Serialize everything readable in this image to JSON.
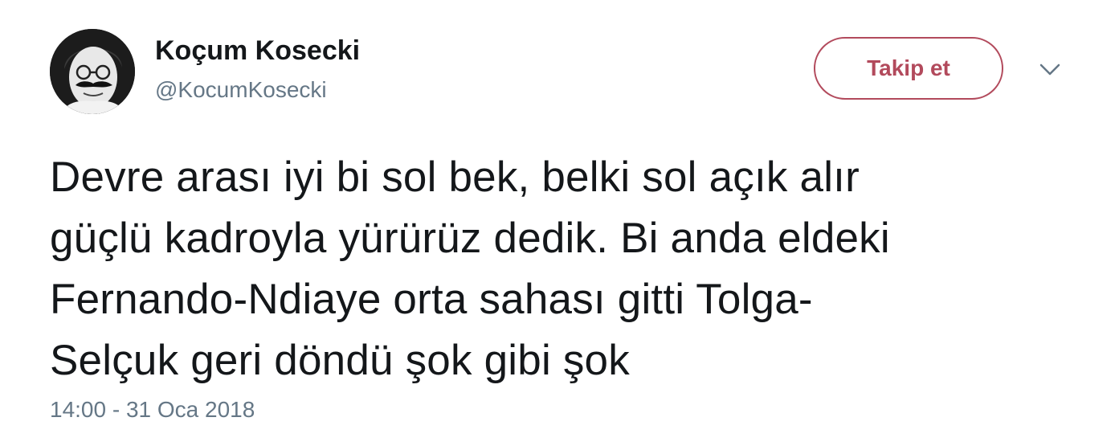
{
  "user": {
    "display_name": "Koçum Kosecki",
    "handle": "@KocumKosecki",
    "avatar_icon": "profile-photo"
  },
  "follow_button": {
    "label": "Takip et",
    "color": "#b24a5c"
  },
  "menu": {
    "icon": "chevron-down-icon"
  },
  "tweet": {
    "text": "Devre arası iyi bi sol bek, belki sol açık alır\ngüçlü kadroyla yürürüz dedik. Bi anda eldeki\nFernando-Ndiaye orta sahası gitti Tolga-\nSelçuk geri döndü şok gibi şok",
    "timestamp": "14:00 - 31 Oca 2018"
  },
  "colors": {
    "text": "#14171a",
    "secondary": "#657786"
  }
}
